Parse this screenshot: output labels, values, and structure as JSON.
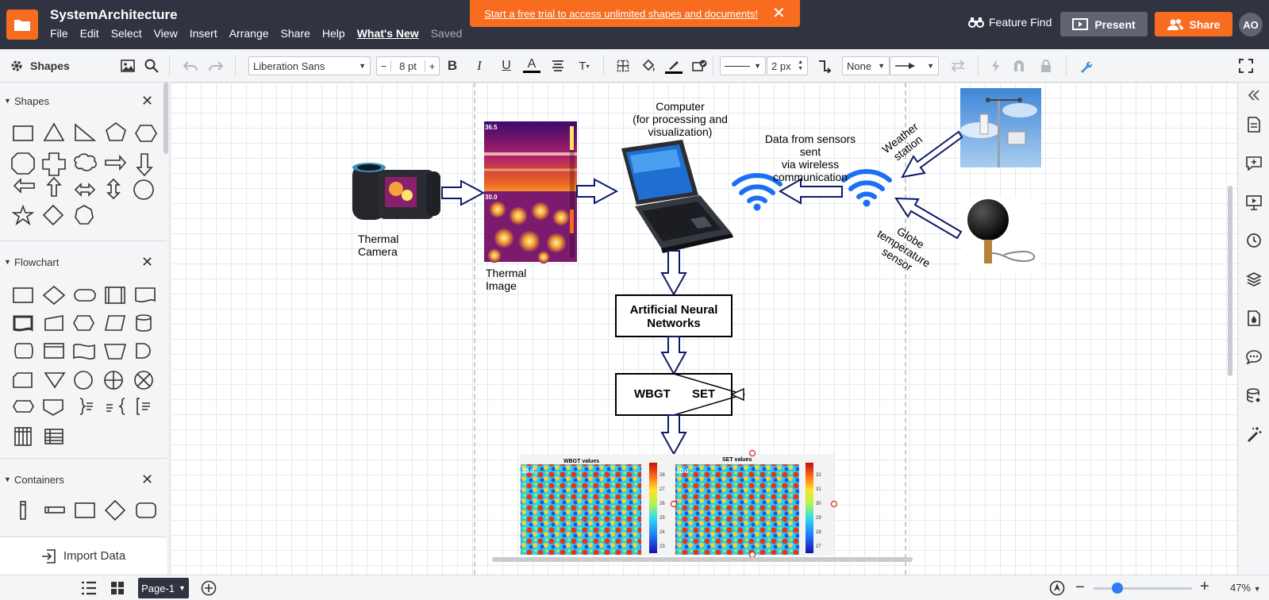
{
  "header": {
    "doc_title": "SystemArchitecture",
    "menu": [
      "File",
      "Edit",
      "Select",
      "View",
      "Insert",
      "Arrange",
      "Share",
      "Help"
    ],
    "whats_new": "What's New",
    "saved": "Saved",
    "trial_text": "Start a free trial to access unlimited shapes and documents!",
    "trial_close": "✕",
    "feature_find": "Feature Find",
    "present": "Present",
    "share": "Share",
    "avatar_initials": "AO"
  },
  "toolbar": {
    "shapes_title": "Shapes",
    "font_family": "Liberation Sans",
    "font_size": "8 pt",
    "font_dec": "−",
    "font_inc": "+",
    "line_width": "2 px",
    "arrow_start": "None"
  },
  "left_panel": {
    "sections": [
      {
        "title": "Shapes"
      },
      {
        "title": "Flowchart"
      },
      {
        "title": "Containers"
      }
    ],
    "import_data": "Import Data"
  },
  "diagram": {
    "thermal_camera": "Thermal Camera",
    "thermal_camera_l1": "Thermal",
    "thermal_camera_l2": "Camera",
    "thermal_image_l1": "Thermal",
    "thermal_image_l2": "Image",
    "computer_l1": "Computer",
    "computer_l2": "(for processing and",
    "computer_l3": "visualization)",
    "data_l1": "Data from sensors",
    "data_l2": "sent",
    "data_l3": "via wireless",
    "data_l4": "communication",
    "weather_l1": "Weather",
    "weather_l2": "station",
    "globe_l1": "Globe",
    "globe_l2": "temperature",
    "globe_l3": "sensor",
    "ann_l1": "Artificial Neural",
    "ann_l2": "Networks",
    "wbgt": "WBGT",
    "set": "SET",
    "wbgt_values": "WBGT values",
    "set_values": "SET values",
    "thermal_temp_top": "36.5",
    "thermal_temp_mid": "30.0",
    "heat_temp_1": "30.0",
    "heat_temp_2": "30.0",
    "wbgt_ticks": [
      "28",
      "27",
      "26",
      "25",
      "24",
      "23"
    ],
    "set_ticks": [
      "32",
      "31",
      "30",
      "29",
      "28",
      "27"
    ]
  },
  "bottombar": {
    "page_tab": "Page-1",
    "zoom": "47%"
  },
  "colors": {
    "accent": "#f76c1e",
    "header_bg": "#2f3440",
    "wifi_blue": "#1a6ff5",
    "arrow_navy": "#0b1a6e"
  }
}
